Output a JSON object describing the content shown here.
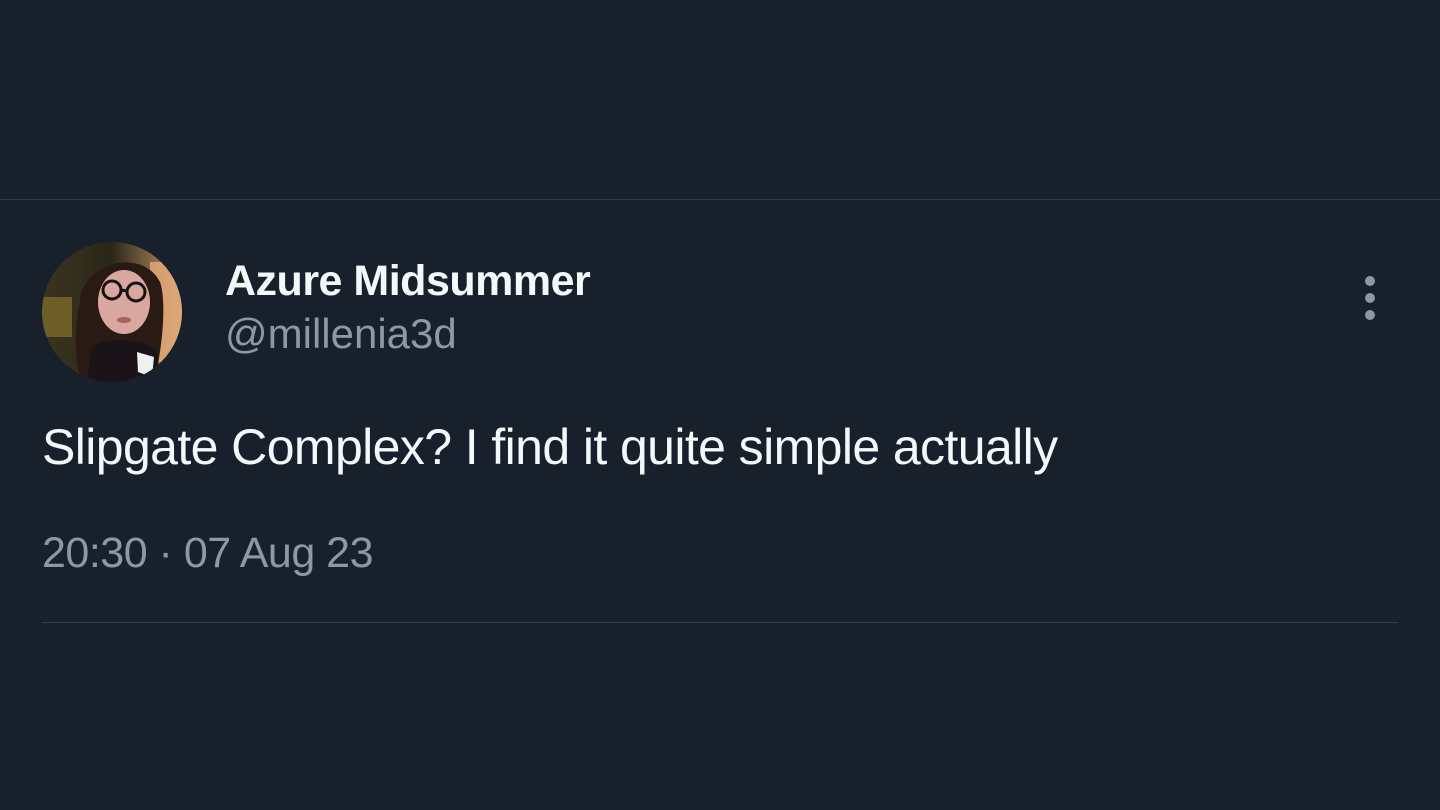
{
  "tweet": {
    "author": {
      "display_name": "Azure Midsummer",
      "handle": "@millenia3d",
      "avatar": "profile-photo"
    },
    "text": "Slipgate Complex? I find it quite simple actually",
    "timestamp": "20:30 · 07 Aug 23",
    "more_icon": "vertical-ellipsis-icon"
  },
  "colors": {
    "background": "#18202b",
    "primary_text": "#f5f8fa",
    "secondary_text": "#8b98a5",
    "divider": "#323b47"
  }
}
